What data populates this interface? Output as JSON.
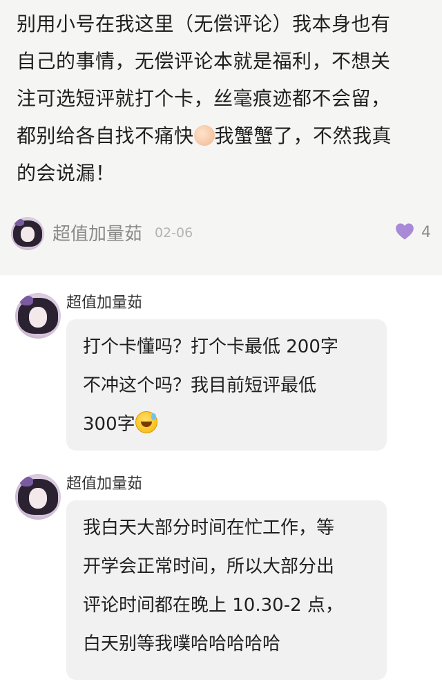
{
  "post": {
    "lines": [
      "别用小号在我这里（无偿评论）我本身也有",
      "自己的事情，无偿评论本就是福利，不想关",
      "注可选短评就打个卡，丝毫痕迹都不会留，",
      "都别给各自找不痛快",
      "我蟹蟹了，不然我真",
      "的会说漏！"
    ],
    "author": "超值加量茹",
    "date": "02-06",
    "likes": "4",
    "like_icon_color": "#a98ad6"
  },
  "replies": [
    {
      "author": "超值加量茹",
      "lines": [
        "打个卡懂吗？打个卡最低 200字",
        "不冲这个吗？我目前短评最低",
        "300字"
      ]
    },
    {
      "author": "超值加量茹",
      "lines": [
        "我白天大部分时间在忙工作，等",
        "开学会正常时间，所以大部分出",
        "评论时间都在晚上 10.30-2 点，",
        "白天别等我噗哈哈哈哈哈"
      ]
    }
  ]
}
